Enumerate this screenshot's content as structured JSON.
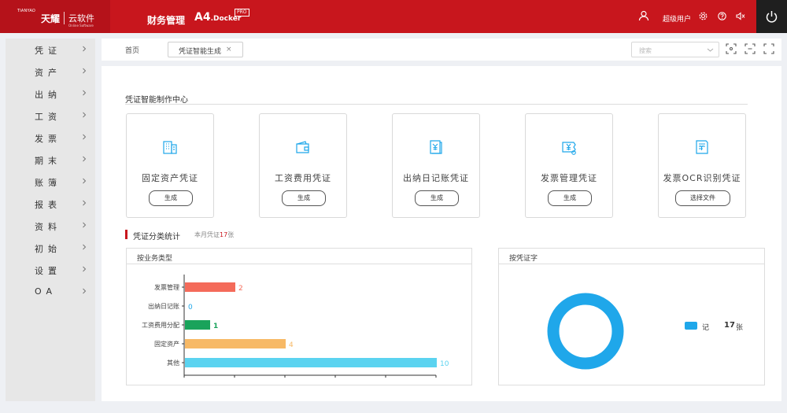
{
  "header": {
    "logo_tiny": "TIANYAO",
    "logo_brand": "天耀",
    "logo_product": "云软件",
    "logo_sub": "Online Software",
    "system_name": "财务管理",
    "product_name": "A4",
    "product_suffix": ".Docker",
    "pro_badge": "PRO",
    "user_name": "超级用户"
  },
  "sidebar": {
    "items": [
      {
        "label": "凭证"
      },
      {
        "label": "资产"
      },
      {
        "label": "出纳"
      },
      {
        "label": "工资"
      },
      {
        "label": "发票"
      },
      {
        "label": "期末"
      },
      {
        "label": "账簿"
      },
      {
        "label": "报表"
      },
      {
        "label": "资料"
      },
      {
        "label": "初始"
      },
      {
        "label": "设置"
      },
      {
        "label": "OA"
      }
    ]
  },
  "tabbar": {
    "home": "首页",
    "active_tab": "凭证智能生成",
    "close_glyph": "×",
    "search_placeholder": "搜索"
  },
  "main": {
    "section_title": "凭证智能制作中心",
    "cards": [
      {
        "title": "固定资产凭证",
        "button": "生成",
        "icon": "building-icon"
      },
      {
        "title": "工资费用凭证",
        "button": "生成",
        "icon": "wallet-icon"
      },
      {
        "title": "出纳日记账凭证",
        "button": "生成",
        "icon": "cash-book-icon"
      },
      {
        "title": "发票管理凭证",
        "button": "生成",
        "icon": "invoice-money-icon"
      },
      {
        "title": "发票OCR识别凭证",
        "button": "选择文件",
        "icon": "ocr-scan-icon"
      }
    ],
    "stats": {
      "title": "凭证分类统计",
      "sub_prefix": "本月凭证",
      "sub_count": "17",
      "sub_unit": "张"
    },
    "panel_business": {
      "title": "按业务类型"
    },
    "panel_word": {
      "title": "按凭证字",
      "legend_label": "记",
      "legend_count": "17",
      "legend_unit": "张"
    }
  },
  "colors": {
    "brand_red": "#c8161d",
    "icon_blue": "#1fa7ea"
  },
  "chart_data": [
    {
      "type": "bar",
      "orientation": "horizontal",
      "categories": [
        "发票管理",
        "出纳日记账",
        "工资费用分配",
        "固定资产",
        "其他"
      ],
      "values": [
        2,
        0,
        1,
        4,
        10
      ],
      "colors": [
        "#f46b5a",
        "#1fa7ea",
        "#1aa35b",
        "#f7b966",
        "#5bd3f0"
      ],
      "xlim": [
        0,
        10
      ],
      "grid": false
    },
    {
      "type": "pie",
      "style": "donut",
      "labels": [
        "记"
      ],
      "values": [
        17
      ],
      "colors": [
        "#1fa7ea"
      ],
      "legend": "right"
    }
  ]
}
